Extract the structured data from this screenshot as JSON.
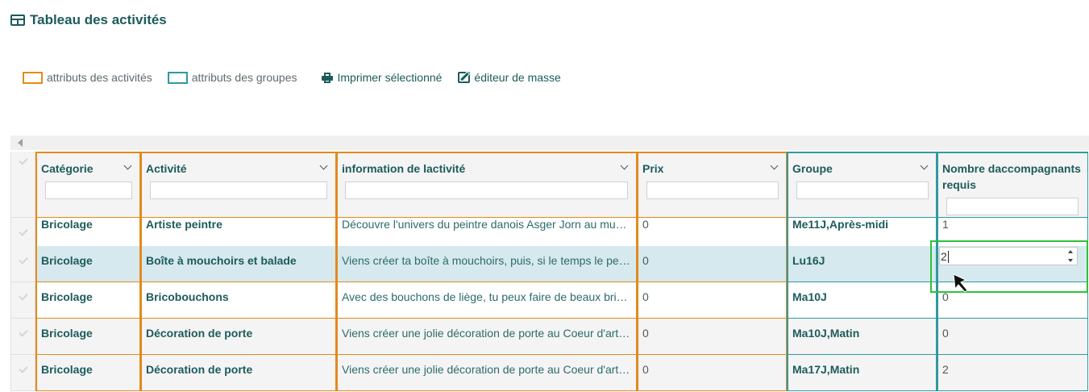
{
  "header": {
    "title": "Tableau des activités",
    "icon": "table-icon"
  },
  "toolbar": {
    "legend_activities": "attributs des activités",
    "legend_groups": "attributs des groupes",
    "print_label": "Imprimer sélectionné",
    "mass_edit_label": "éditeur de masse"
  },
  "colors": {
    "activity_border": "#e38a1c",
    "group_border": "#2f9aa0",
    "focus": "#2cc23a",
    "selected_row": "#d6e9ee"
  },
  "columns": [
    "Catégorie",
    "Activité",
    "information de lactivité",
    "Prix",
    "Groupe",
    "Nombre daccompagnants requis"
  ],
  "rows": [
    {
      "cat": "Bricolage",
      "act": "Artiste peintre",
      "info": "Découvre l'univers du peintre danois Asger Jorn au musée",
      "prix": "0",
      "groupe": "Me11J,Après-midi",
      "nb": "1"
    },
    {
      "cat": "Bricolage",
      "act": "Boîte à mouchoirs et balade",
      "info": "Viens créer ta boîte à mouchoirs, puis, si le temps le permet",
      "prix": "0",
      "groupe": "Lu16J",
      "nb": "2"
    },
    {
      "cat": "Bricolage",
      "act": "Bricobouchons",
      "info": "Avec des bouchons de liège, tu peux faire de beaux bricolages",
      "prix": "0",
      "groupe": "Ma10J",
      "nb": "0"
    },
    {
      "cat": "Bricolage",
      "act": "Décoration de porte",
      "info": "Viens créer une jolie décoration de porte au Coeur d'artichaut",
      "prix": "0",
      "groupe": "Ma10J,Matin",
      "nb": "0"
    },
    {
      "cat": "Bricolage",
      "act": "Décoration de porte",
      "info": "Viens créer une jolie décoration de porte au Coeur d'artichaut",
      "prix": "0",
      "groupe": "Ma17J,Matin",
      "nb": "2"
    }
  ]
}
